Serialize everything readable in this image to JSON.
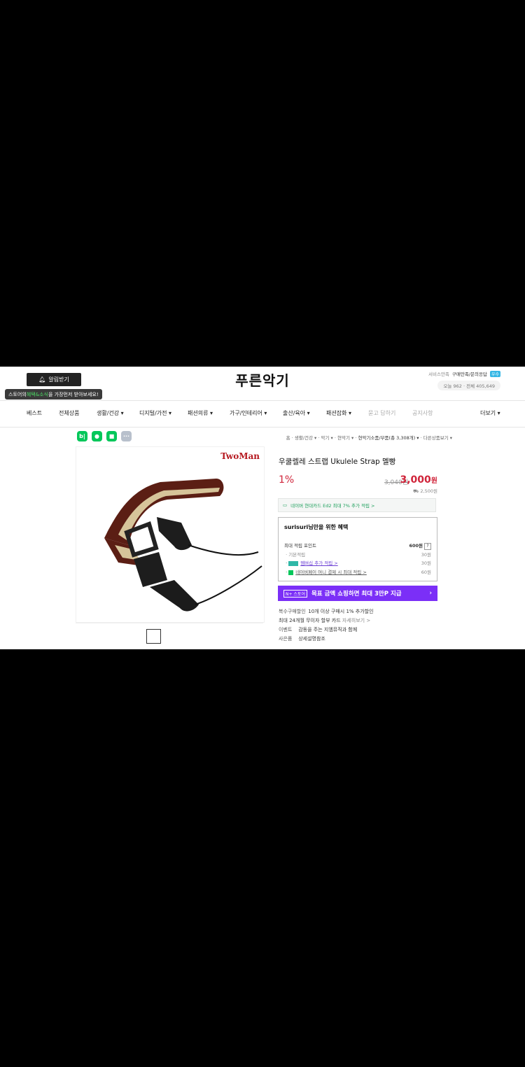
{
  "header": {
    "alarm_label": "알림받기",
    "tooltip_prefix": "스토어의 ",
    "tooltip_highlight": "혜택&소식",
    "tooltip_suffix": "을 가장먼저 받아보세요!",
    "store_name": "푸른악기",
    "service_label": "서비스만족",
    "service_value": "구매만족/문의응답",
    "service_badge": "우수",
    "visit_text": "오늘 962 · 전체 405,649"
  },
  "nav": {
    "items": [
      "베스트",
      "전체상품",
      "생활/건강 ▾",
      "디지털/가전 ▾",
      "패션의류 ▾",
      "가구/인테리어 ▾",
      "출산/육아 ▾",
      "패션잡화 ▾",
      "묻고 답하기",
      "공지사항",
      "더보기 ▾"
    ]
  },
  "share": {
    "b": "b|",
    "talk": "●",
    "save": "■",
    "more": "···"
  },
  "breadcrumb": {
    "home": "홈",
    "c1": "생활/건강 ▾",
    "c2": "악기 ▾",
    "c3": "현악기 ▾",
    "c4": "현악기소품/부품(총 3,308개) ▾",
    "other": "다른상품보기 ▾"
  },
  "product": {
    "brand": "TwoMan",
    "name": "우쿨렐레 스트랩 Ukulele Strap 멜빵",
    "discount": "1%",
    "original_price": "3,040원",
    "price": "3,000",
    "price_unit": "원",
    "shipping": "2,500원",
    "card_banner": "네이버 현대카드 Ed2 최대 7% 추가 적립 >"
  },
  "benefit": {
    "title": "surisuri님만을 위한 혜택",
    "max_points_label": "최대 적립 포인트",
    "max_points_value": "600원",
    "basic_label": "기본적립",
    "basic_value": "30원",
    "membership_label": "멤버십 추가 적립 >",
    "membership_value": "30원",
    "pay_label": "네이버페이 머니 결제 시 최대 적립 >",
    "pay_value": "60원"
  },
  "promo": {
    "tag": "N+ 스토어",
    "text": "목표 금액 쇼핑하면 최대 3만P 지급",
    "arrow": "›"
  },
  "extra": {
    "multi_label": "복수구매할인",
    "multi_value": "10개 이상 구매시 1% 추가할인",
    "install_value": "최대 24개월 무이자 할부 카드",
    "install_more": "자세히보기 >",
    "event_label": "이벤트",
    "event_value": "감동을 주는 지엠뮤직과 함께",
    "gift_label": "사은품",
    "gift_value": "상세설명참조"
  },
  "colors": {
    "brand_green": "#03c75a",
    "price_red": "#d0243a",
    "promo_purple": "#7b2ff7"
  }
}
